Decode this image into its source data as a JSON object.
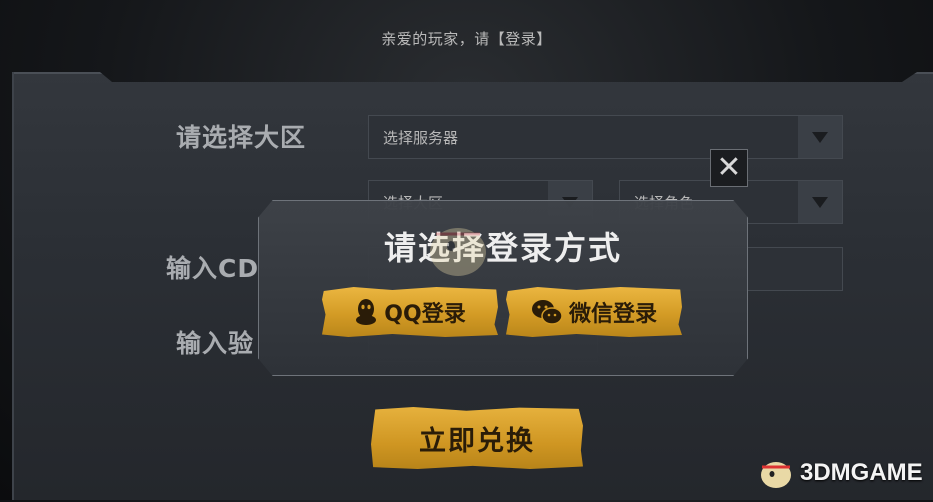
{
  "header": {
    "greeting": "亲爱的玩家，请【登录】"
  },
  "form": {
    "region_label": "请选择大区",
    "server_select": {
      "value": "选择服务器"
    },
    "zone_select": {
      "value": "选择大区"
    },
    "role_select": {
      "value": "选择角色"
    },
    "cdkey_label": "输入CD",
    "captcha_label": "输入验"
  },
  "modal": {
    "title": "请选择登录方式",
    "qq_label": "QQ登录",
    "wechat_label": "微信登录",
    "close_symbol": "✕"
  },
  "redeem": {
    "label": "立即兑换"
  },
  "watermark": {
    "text": "3DMGAME"
  },
  "colors": {
    "gold": "#d39b25",
    "panel": "#2b2f35",
    "modal_bg": "#3e4248"
  }
}
